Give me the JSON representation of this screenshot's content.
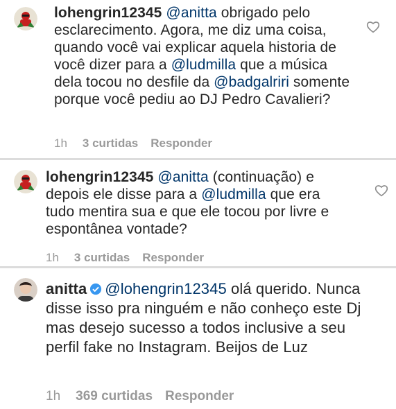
{
  "comments": [
    {
      "username": "lohengrin12345",
      "mention": "@anitta",
      "text_parts": [
        " obrigado pelo esclarecimento. Agora, me diz uma coisa, quando você vai explicar aquela historia de você dizer para a ",
        " que a música dela tocou no desfile da ",
        " somente porque você pediu ao DJ Pedro Cavalieri?"
      ],
      "mentions_inline": [
        "@ludmilla",
        "@badgalriri"
      ],
      "time": "1h",
      "likes": "3 curtidas",
      "reply": "Responder",
      "avatar_icon": "profile-avatar-icon",
      "like_icon": "heart-icon"
    },
    {
      "username": "lohengrin12345",
      "mention": "@anitta",
      "text_parts": [
        " (continuação) e depois ele disse para a ",
        " que era tudo mentira sua e que ele tocou por livre e espontânea vontade?"
      ],
      "mentions_inline": [
        "@ludmilla"
      ],
      "time": "1h",
      "likes": "3 curtidas",
      "reply": "Responder",
      "avatar_icon": "profile-avatar-icon",
      "like_icon": "heart-icon"
    },
    {
      "username": "anitta",
      "verified_icon": "verified-badge-icon",
      "mention": "@lohengrin12345",
      "text_parts": [
        " olá querido. Nunca disse isso pra ninguém e não conheço este Dj mas desejo sucesso a todos inclusive a seu perfil fake no Instagram. Beijos de Luz"
      ],
      "time": "1h",
      "likes": "369 curtidas",
      "reply": "Responder",
      "avatar_icon": "profile-avatar-icon"
    }
  ],
  "colors": {
    "text": "#262626",
    "mention": "#003569",
    "meta": "#999999",
    "verified": "#3897f0",
    "divider": "#dcdcdc"
  }
}
